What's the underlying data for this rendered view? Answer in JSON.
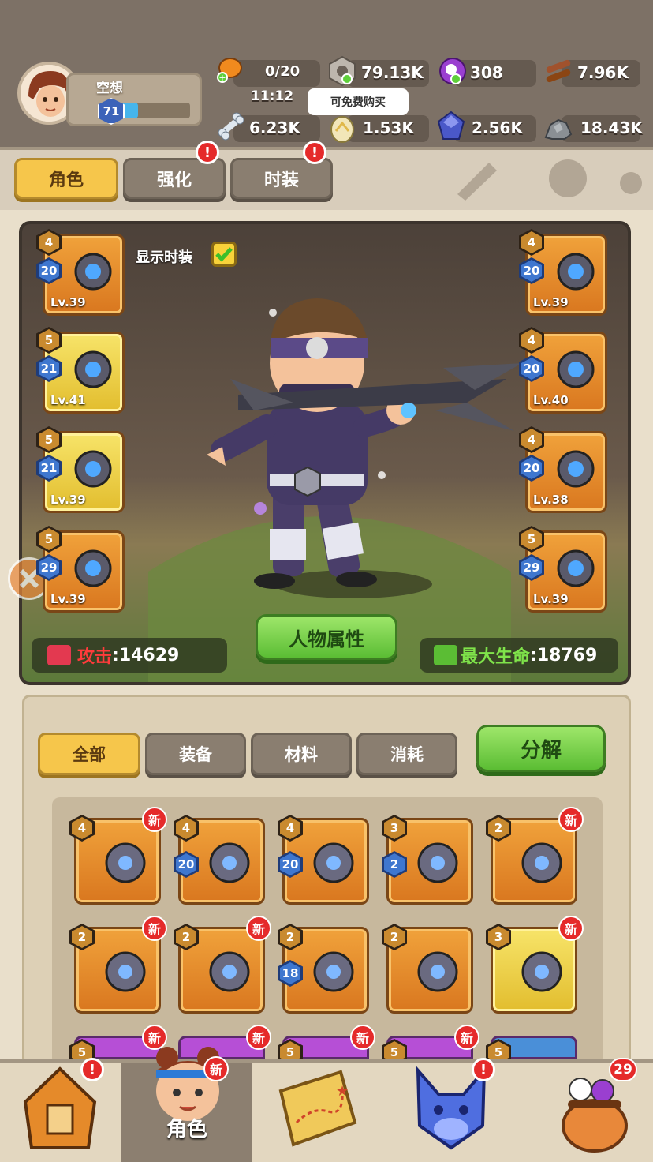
{
  "player": {
    "name": "空想",
    "level": "71"
  },
  "resources": {
    "stamina": "0/20",
    "stamina_timer": "11:12",
    "hex_coin": "79.13K",
    "gem": "308",
    "wood": "7.96K",
    "bone": "6.23K",
    "egg": "1.53K",
    "crystal": "2.56K",
    "stone": "18.43K"
  },
  "tooltip": "可免费购买",
  "tabs": [
    "角色",
    "强化",
    "时装"
  ],
  "show_costume_label": "显示时装",
  "left_slots": [
    {
      "quality": "4",
      "star": "20",
      "level": "Lv.39",
      "color": "orange"
    },
    {
      "quality": "5",
      "star": "21",
      "level": "Lv.41",
      "color": "yellow"
    },
    {
      "quality": "5",
      "star": "21",
      "level": "Lv.39",
      "color": "yellow"
    },
    {
      "quality": "5",
      "star": "29",
      "level": "Lv.39",
      "color": "orange"
    }
  ],
  "right_slots": [
    {
      "quality": "4",
      "star": "20",
      "level": "Lv.39",
      "color": "orange"
    },
    {
      "quality": "4",
      "star": "20",
      "level": "Lv.40",
      "color": "orange"
    },
    {
      "quality": "4",
      "star": "20",
      "level": "Lv.38",
      "color": "orange"
    },
    {
      "quality": "5",
      "star": "29",
      "level": "Lv.39",
      "color": "orange"
    }
  ],
  "attack": {
    "label": "攻击",
    "value": ":14629"
  },
  "hp": {
    "label": "最大生命",
    "value": ":18769"
  },
  "attributes_button": "人物属性",
  "filter_tabs": [
    "全部",
    "装备",
    "材料",
    "消耗"
  ],
  "decompose_button": "分解",
  "new_badge": "新",
  "inventory_row1": [
    {
      "quality": "4",
      "star": "",
      "new": true
    },
    {
      "quality": "4",
      "star": "20",
      "new": false
    },
    {
      "quality": "4",
      "star": "20",
      "new": false
    },
    {
      "quality": "3",
      "star": "2",
      "new": false
    },
    {
      "quality": "2",
      "star": "",
      "new": true
    }
  ],
  "inventory_row2": [
    {
      "quality": "2",
      "star": "",
      "new": true
    },
    {
      "quality": "2",
      "star": "",
      "new": true
    },
    {
      "quality": "2",
      "star": "18",
      "new": false
    },
    {
      "quality": "2",
      "star": "",
      "new": false
    },
    {
      "quality": "3",
      "star": "",
      "new": true
    }
  ],
  "inventory_row3": [
    {
      "quality": "5",
      "new": true
    },
    {
      "quality": "",
      "new": true
    },
    {
      "quality": "5",
      "new": true
    },
    {
      "quality": "5",
      "new": true
    },
    {
      "quality": "5",
      "new": false
    }
  ],
  "nav": {
    "character_label": "角色",
    "pet_badge": "!",
    "bag_count": "29"
  },
  "colors": {
    "accent": "#f6c64b",
    "green": "#5bbd34",
    "alert": "#e52a2a",
    "orange_slot": "#e88a2a"
  }
}
